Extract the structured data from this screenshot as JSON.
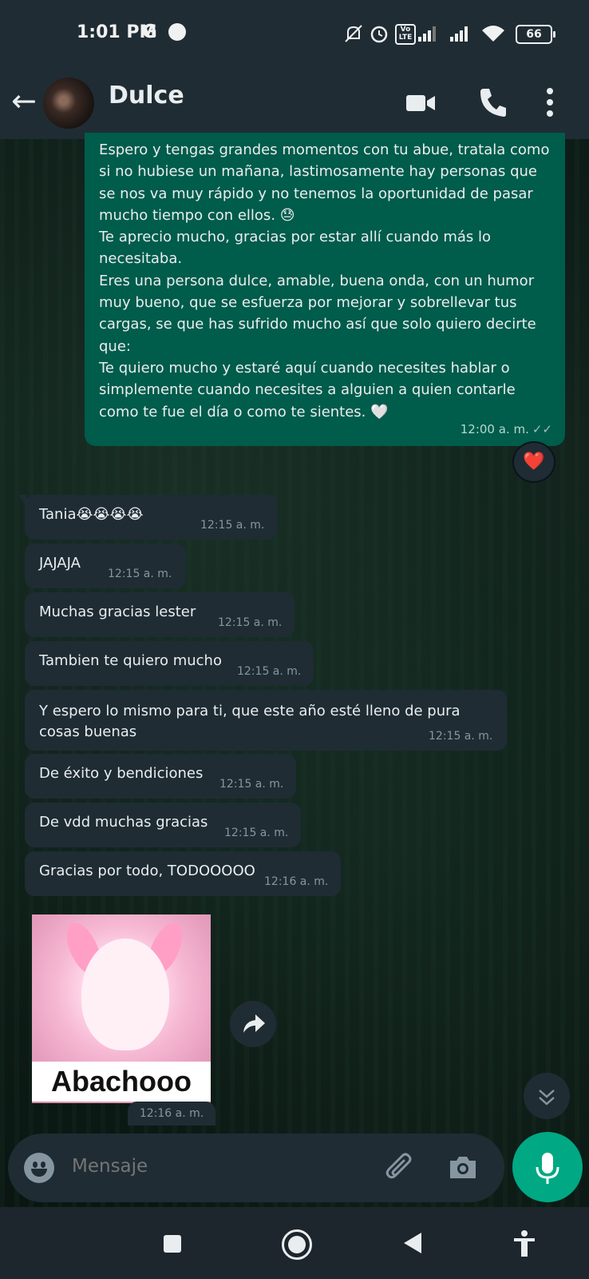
{
  "status_bar": {
    "time": "1:01 PM",
    "g_label": "G",
    "volte": "Vo LTE",
    "battery": "66",
    "icons": [
      "navigation-icon",
      "mute-icon",
      "alarm-icon",
      "volte-icon",
      "signal-icon",
      "signal-icon",
      "wifi-icon",
      "battery-icon"
    ]
  },
  "header": {
    "contact_name": "Dulce",
    "icons": [
      "back-arrow-icon",
      "video-call-icon",
      "phone-call-icon",
      "more-options-icon"
    ]
  },
  "messages": [
    {
      "direction": "outgoing",
      "text": "Espero y tengas grandes momentos con tu abue, tratala como si no hubiese un mañana, lastimosamente hay personas que se nos va muy rápido y no tenemos la oportunidad de pasar mucho tiempo con ellos. 😓\nTe aprecio mucho, gracias por estar allí cuando más lo necesitaba.\nEres una persona dulce, amable, buena onda, con un humor muy bueno, que se esfuerza por mejorar y sobrellevar tus cargas, se que has sufrido mucho así que solo quiero decirte que:\nTe quiero mucho y estaré aquí cuando necesites hablar o simplemente cuando necesites a alguien a quien contarle como te fue el día o como te sientes. 🤍",
      "time": "12:00 a. m.",
      "reaction": "❤️"
    },
    {
      "direction": "incoming",
      "text": "Tania😭😭😭😭",
      "time": "12:15 a. m."
    },
    {
      "direction": "incoming",
      "text": "JAJAJA",
      "time": "12:15 a. m."
    },
    {
      "direction": "incoming",
      "text": "Muchas gracias lester",
      "time": "12:15 a. m."
    },
    {
      "direction": "incoming",
      "text": "Tambien te quiero mucho",
      "time": "12:15 a. m."
    },
    {
      "direction": "incoming",
      "text": "Y espero lo mismo para ti, que este año esté lleno de pura\ncosas buenas",
      "time": "12:15 a. m."
    },
    {
      "direction": "incoming",
      "text": "De éxito y bendiciones",
      "time": "12:15 a. m."
    },
    {
      "direction": "incoming",
      "text": "De vdd muchas gracias",
      "time": "12:15 a. m."
    },
    {
      "direction": "incoming",
      "text": "Gracias por todo, TODOOOOO",
      "time": "12:16 a. m."
    },
    {
      "direction": "incoming",
      "type": "sticker",
      "sticker_text": "Abachooo",
      "time": "12:16 a. m."
    }
  ],
  "composer": {
    "placeholder": "Mensaje",
    "icons": [
      "emoji-icon",
      "attach-icon",
      "camera-icon",
      "microphone-icon"
    ]
  },
  "colors": {
    "outgoing_bubble": "#005c4b",
    "incoming_bubble": "#1f2c34",
    "bar": "#1f2c34",
    "accent": "#00a884"
  }
}
